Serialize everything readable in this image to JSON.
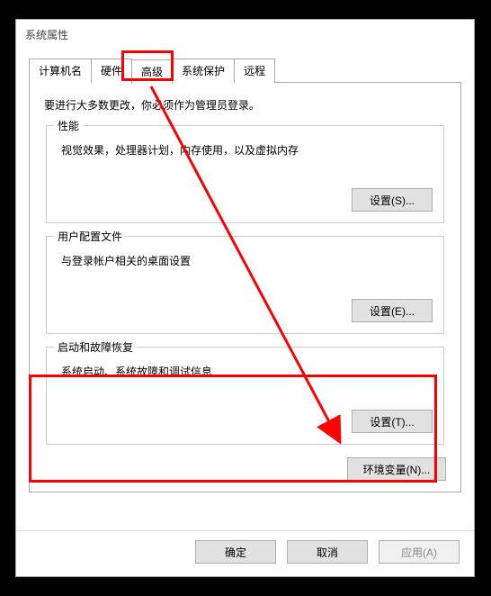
{
  "window": {
    "title": "系统属性"
  },
  "tabs": {
    "items": [
      {
        "label": "计算机名"
      },
      {
        "label": "硬件"
      },
      {
        "label": "高级"
      },
      {
        "label": "系统保护"
      },
      {
        "label": "远程"
      }
    ],
    "active_index": 2
  },
  "panel": {
    "intro": "要进行大多数更改，你必须作为管理员登录。"
  },
  "groups": {
    "performance": {
      "title": "性能",
      "desc": "视觉效果，处理器计划，内存使用，以及虚拟内存",
      "button": "设置(S)..."
    },
    "profiles": {
      "title": "用户配置文件",
      "desc": "与登录帐户相关的桌面设置",
      "button": "设置(E)..."
    },
    "startup": {
      "title": "启动和故障恢复",
      "desc": "系统启动、系统故障和调试信息",
      "button": "设置(T)..."
    }
  },
  "env_button": "环境变量(N)...",
  "buttons": {
    "ok": "确定",
    "cancel": "取消",
    "apply": "应用(A)"
  },
  "annotation": {
    "highlight_tab_index": 2,
    "highlight_group": "startup"
  }
}
